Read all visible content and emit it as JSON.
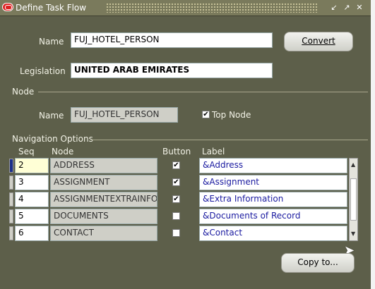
{
  "window": {
    "title": "Define Task Flow"
  },
  "form": {
    "name_label": "Name",
    "name_value": "FUJ_HOTEL_PERSON",
    "legislation_label": "Legislation",
    "legislation_value": "UNITED ARAB EMIRATES",
    "convert_label": "Convert"
  },
  "node_section": {
    "title": "Node",
    "name_label": "Name",
    "name_value": "FUJ_HOTEL_PERSON",
    "top_node_label": "Top Node",
    "top_node_checked": true
  },
  "nav_section": {
    "title": "Navigation Options",
    "headers": {
      "seq": "Seq",
      "node": "Node",
      "button": "Button",
      "label": "Label"
    },
    "rows": [
      {
        "seq": "2",
        "node": "ADDRESS",
        "button": "✔",
        "label": "&Address"
      },
      {
        "seq": "3",
        "node": "ASSIGNMENT",
        "button": "✔",
        "label": "&Assignment"
      },
      {
        "seq": "4",
        "node": "ASSIGNMENTEXTRAINFO",
        "button": "✔",
        "label": "&Extra Information"
      },
      {
        "seq": "5",
        "node": "DOCUMENTS",
        "button": "",
        "label": "&Documents of Record"
      },
      {
        "seq": "6",
        "node": "CONTACT",
        "button": "",
        "label": "&Contact"
      }
    ]
  },
  "copy_button": "Copy to..."
}
